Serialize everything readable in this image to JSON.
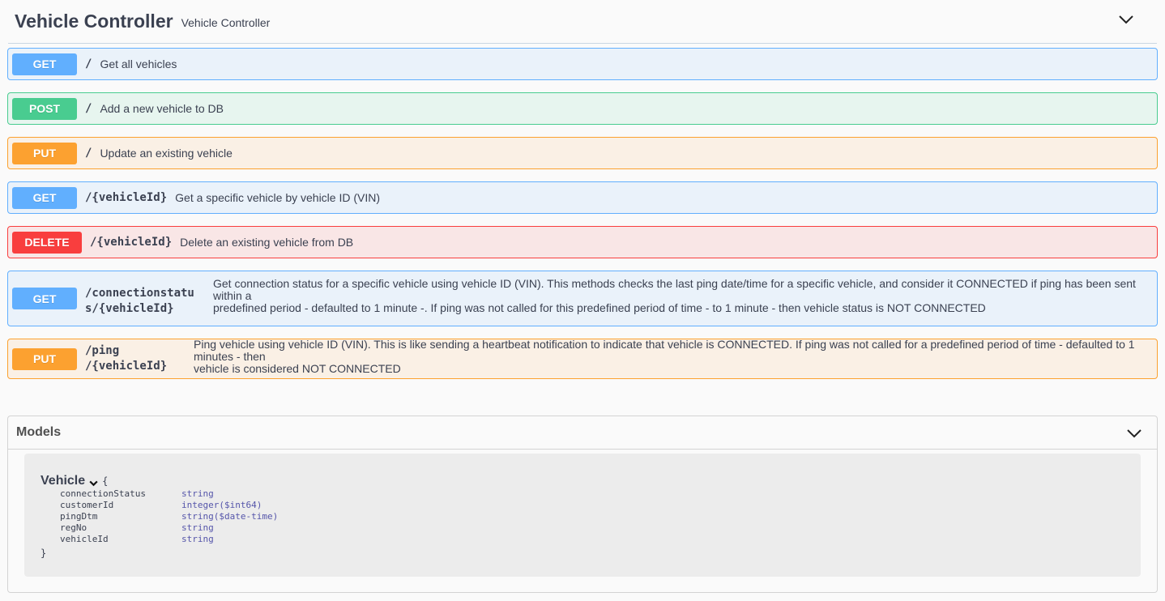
{
  "tag": {
    "title": "Vehicle Controller",
    "description": "Vehicle Controller",
    "toggle_icon": "chevron-down-icon"
  },
  "operations": [
    {
      "method": "GET",
      "path": "/",
      "summary": "Get all vehicles"
    },
    {
      "method": "POST",
      "path": "/",
      "summary": "Add a new vehicle to DB"
    },
    {
      "method": "PUT",
      "path": "/",
      "summary": "Update an existing vehicle"
    },
    {
      "method": "GET",
      "path": "/{vehicleId}",
      "summary": "Get a specific vehicle by vehicle ID (VIN)"
    },
    {
      "method": "DELETE",
      "path": "/{vehicleId}",
      "summary": "Delete an existing vehicle from DB"
    },
    {
      "method": "GET",
      "path_lines": [
        "/connectionstatu",
        "s/{vehicleId}"
      ],
      "summary_lines": [
        "Get connection status for a specific vehicle using vehicle ID (VIN). This methods checks the last ping date/time for a specific vehicle, and consider it CONNECTED if ping has been sent within a",
        "predefined period - defaulted to 1 minute -. If ping was not called for this predefined period of time - to 1 minute - then vehicle status is NOT CONNECTED"
      ]
    },
    {
      "method": "PUT",
      "path_lines": [
        "/ping",
        "/{vehicleId}"
      ],
      "summary_lines": [
        "Ping vehicle using vehicle ID (VIN). This is like sending a heartbeat notification to indicate that vehicle is CONNECTED. If ping was not called for a predefined period of time - defaulted to 1 minutes - then",
        "vehicle is considered NOT CONNECTED"
      ]
    }
  ],
  "models": {
    "title": "Models",
    "model": {
      "name": "Vehicle",
      "open_brace": "{",
      "close_brace": "}",
      "properties": [
        {
          "name": "connectionStatus",
          "type": "string"
        },
        {
          "name": "customerId",
          "type": "integer($int64)"
        },
        {
          "name": "pingDtm",
          "type": "string($date-time)"
        },
        {
          "name": "regNo",
          "type": "string"
        },
        {
          "name": "vehicleId",
          "type": "string"
        }
      ]
    }
  },
  "colors": {
    "get": "#61affe",
    "post": "#49cc90",
    "put": "#fca130",
    "delete": "#f93e3e"
  }
}
